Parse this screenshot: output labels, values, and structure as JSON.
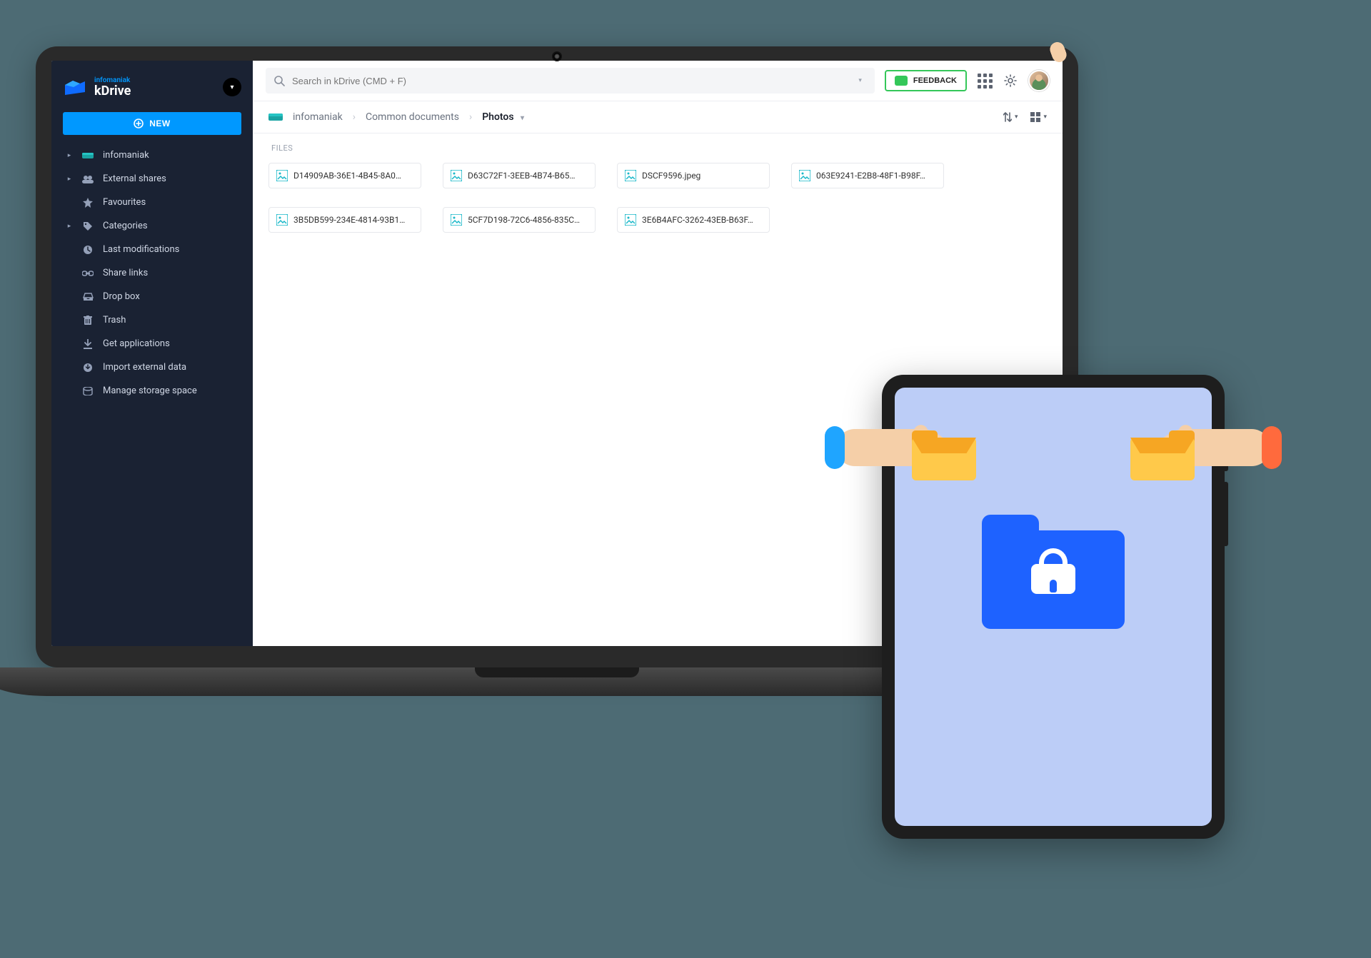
{
  "brand": {
    "sub": "infomaniak",
    "main": "kDrive"
  },
  "new_button": "NEW",
  "sidebar": {
    "items": [
      {
        "label": "infomaniak",
        "expandable": true
      },
      {
        "label": "External shares",
        "expandable": true
      },
      {
        "label": "Favourites",
        "expandable": false
      },
      {
        "label": "Categories",
        "expandable": true
      },
      {
        "label": "Last modifications",
        "expandable": false
      },
      {
        "label": "Share links",
        "expandable": false
      },
      {
        "label": "Drop box",
        "expandable": false
      },
      {
        "label": "Trash",
        "expandable": false
      },
      {
        "label": "Get applications",
        "expandable": false
      },
      {
        "label": "Import external data",
        "expandable": false
      },
      {
        "label": "Manage storage space",
        "expandable": false
      }
    ]
  },
  "search": {
    "placeholder": "Search in kDrive (CMD + F)"
  },
  "feedback": "FEEDBACK",
  "breadcrumbs": {
    "root": "infomaniak",
    "mid": "Common documents",
    "current": "Photos"
  },
  "section_label": "FILES",
  "files": [
    {
      "name": "D14909AB-36E1-4B45-8A0…"
    },
    {
      "name": "D63C72F1-3EEB-4B74-B65…"
    },
    {
      "name": "DSCF9596.jpeg"
    },
    {
      "name": "063E9241-E2B8-48F1-B98F…"
    },
    {
      "name": "3B5DB599-234E-4814-93B1…"
    },
    {
      "name": "5CF7D198-72C6-4856-835C…"
    },
    {
      "name": "3E6B4AFC-3262-43EB-B63F…"
    }
  ]
}
